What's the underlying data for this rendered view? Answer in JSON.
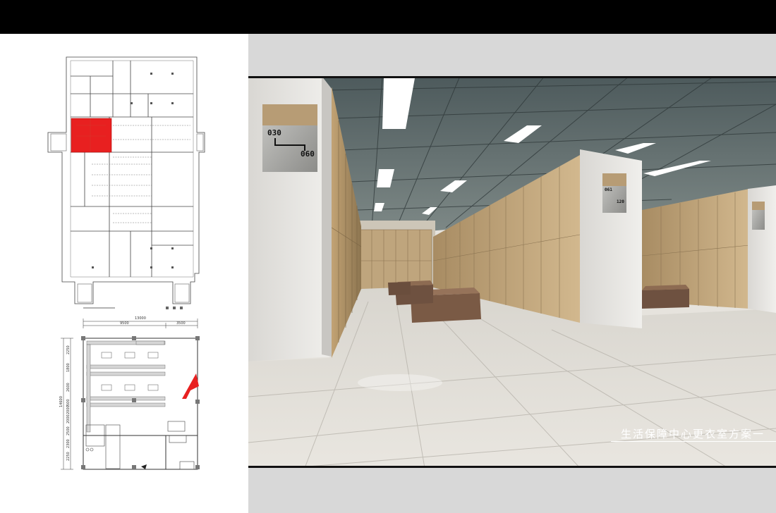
{
  "render": {
    "caption": "生活保障中心更衣室方案一",
    "signs": {
      "front": {
        "from": "030",
        "to": "060"
      },
      "middle": {
        "from": "061",
        "to": "120"
      }
    }
  },
  "plan": {
    "total_width": "13000",
    "width_left": "9500",
    "width_right": "3500",
    "total_depth": "14600",
    "depth_segments": [
      "2250",
      "2300",
      "2500",
      "2000",
      "2000",
      "500",
      "2600",
      "1800",
      "2250"
    ]
  },
  "colors": {
    "highlight": "#e82020",
    "locker": "#c9ab7c",
    "bench": "#7a5a45"
  }
}
